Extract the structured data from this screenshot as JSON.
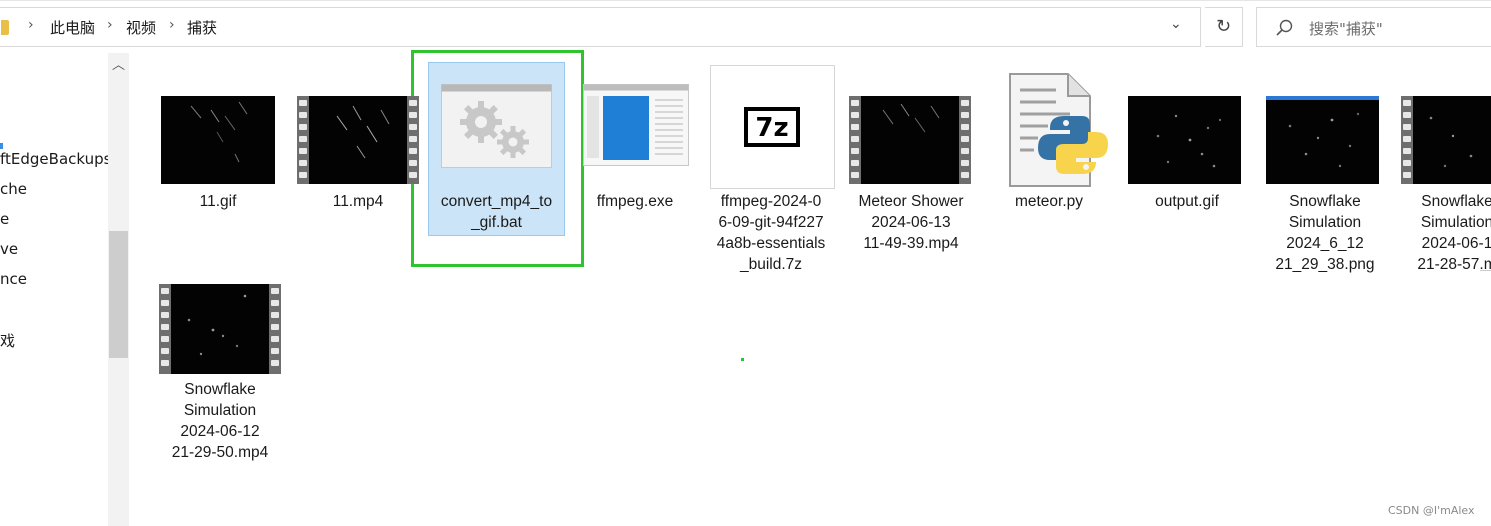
{
  "address_bar": {
    "breadcrumbs": [
      "此电脑",
      "视频",
      "捕获"
    ]
  },
  "search": {
    "placeholder": "搜索\"捕获\""
  },
  "navigation": {
    "items": [
      "ftEdgeBackups",
      "che",
      "e",
      "ve",
      "nce",
      "戏"
    ]
  },
  "files": [
    {
      "label": "11.gif"
    },
    {
      "label": "11.mp4"
    },
    {
      "label": "convert_mp4_to\n_gif.bat"
    },
    {
      "label": "ffmpeg.exe"
    },
    {
      "label": "ffmpeg-2024-0\n6-09-git-94f227\n4a8b-essentials\n_build.7z"
    },
    {
      "label": "Meteor Shower\n2024-06-13\n11-49-39.mp4"
    },
    {
      "label": "meteor.py"
    },
    {
      "label": "output.gif"
    },
    {
      "label": "Snowflake\nSimulation\n2024_6_12\n21_29_38.png"
    },
    {
      "label": "Snowflake\nSimulation\n2024-06-1\n21-28-57.m"
    },
    {
      "label": "Snowflake\nSimulation\n2024-06-12\n21-29-50.mp4"
    }
  ],
  "watermark": "CSDN @I'mAlex",
  "colors": {
    "selection": "#cce4f7",
    "highlight_frame": "#2fc32f",
    "python_blue": "#3572a5",
    "python_yellow": "#f7d44c"
  }
}
